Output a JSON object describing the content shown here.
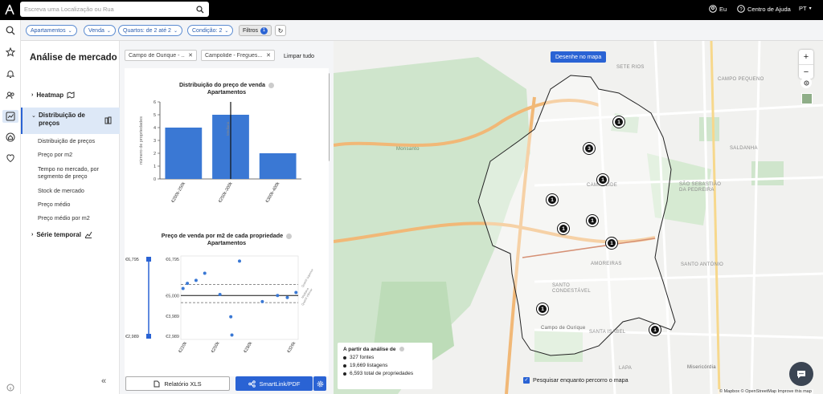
{
  "search": {
    "placeholder": "Escreva uma Localização ou Rua"
  },
  "topbar": {
    "user": "Eu",
    "help": "Centro de Ajuda",
    "lang": "PT"
  },
  "filters": [
    {
      "label": "Apartamentos"
    },
    {
      "label": "Venda"
    },
    {
      "label": "Quartos: de 2 até 2"
    },
    {
      "label": "Condição: 2"
    }
  ],
  "filtros": {
    "label": "Filtros",
    "count": "1"
  },
  "panel": {
    "title": "Análise de mercado",
    "heatmap": "Heatmap",
    "selected": "Distribuição de preços",
    "sub": [
      "Distribuição de preços",
      "Preço por m2",
      "Tempo no mercado, por segmento de preço",
      "Stock de mercado",
      "Preço médio",
      "Preço médio por m2"
    ],
    "serie": "Série temporal"
  },
  "chips": [
    "Campo de Ourique - ...",
    "Campolide - Fregues..."
  ],
  "clear_label": "Limpar tudo",
  "chart1": {
    "title": "Distribuição do preço de venda",
    "subtitle": "Apartamentos"
  },
  "chart2": {
    "title": "Preço de venda por m2 de cada propriedade",
    "subtitle": "Apartamentos"
  },
  "chart_data": [
    {
      "type": "bar",
      "title": "Distribuição do preço de venda",
      "subtitle": "Apartamentos",
      "ylabel": "número de propriedades",
      "categories": [
        "€200k-250k",
        "€250k-300k",
        "€300k-400k"
      ],
      "values": [
        4,
        5,
        2
      ],
      "ylim": [
        0,
        6
      ],
      "yticks": [
        "0",
        "1",
        "2",
        "3",
        "4",
        "5",
        "6"
      ],
      "median_label": "Mediana",
      "bar_color": "#3a78d4"
    },
    {
      "type": "scatter",
      "title": "Preço de venda por m2 de cada propriedade",
      "subtitle": "Apartamentos",
      "slider": {
        "max": "€6,795",
        "min": "€2,989"
      },
      "yticks": [
        "€6,795",
        "€5,000",
        "€3,989",
        "€2,989"
      ],
      "xticks": [
        "€220k",
        "€250k",
        "€280k",
        "€326k"
      ],
      "x": [
        220,
        224,
        232,
        240,
        254,
        264,
        265,
        272,
        293,
        307,
        316,
        324
      ],
      "y": [
        5350,
        5600,
        5750,
        6100,
        5050,
        3950,
        3050,
        6700,
        4700,
        5000,
        4900,
        5150
      ],
      "mean": 5000,
      "quartile_upper": 5550,
      "quartile_lower": 4650,
      "annotations": [
        "Quartil superior",
        "Mediana",
        "Quartil inferior"
      ],
      "point_color": "#3a78d4"
    }
  ],
  "buttons": {
    "xls": "Relatório XLS",
    "smartlink": "SmartLink/PDF"
  },
  "map": {
    "draw": "Desenhe no mapa",
    "labels": [
      "SETE RIOS",
      "CAMPO PEQUENO",
      "SALDANHA",
      "SÃO SEBASTIÃO DA PEDREIRA",
      "CAMPOLIDE",
      "AMOREIRAS",
      "SANTO CONDESTÁVEL",
      "Campo de Ourique",
      "SANTA ISABEL",
      "SANTO ANTÓNIO",
      "LAPA",
      "Misericórdia",
      "Monsanto"
    ],
    "clusters": [
      "1",
      "3",
      "1",
      "1",
      "1",
      "1",
      "1",
      "1",
      "1"
    ],
    "legend": {
      "title": "A partir da análise de",
      "items": [
        "327 fontes",
        "19,669 listagens",
        "6,593 total de propriedades"
      ]
    },
    "search_move": "Pesquisar enquanto percorro o mapa",
    "attribution": "© Mapbox © OpenStreetMap Improve this map"
  }
}
